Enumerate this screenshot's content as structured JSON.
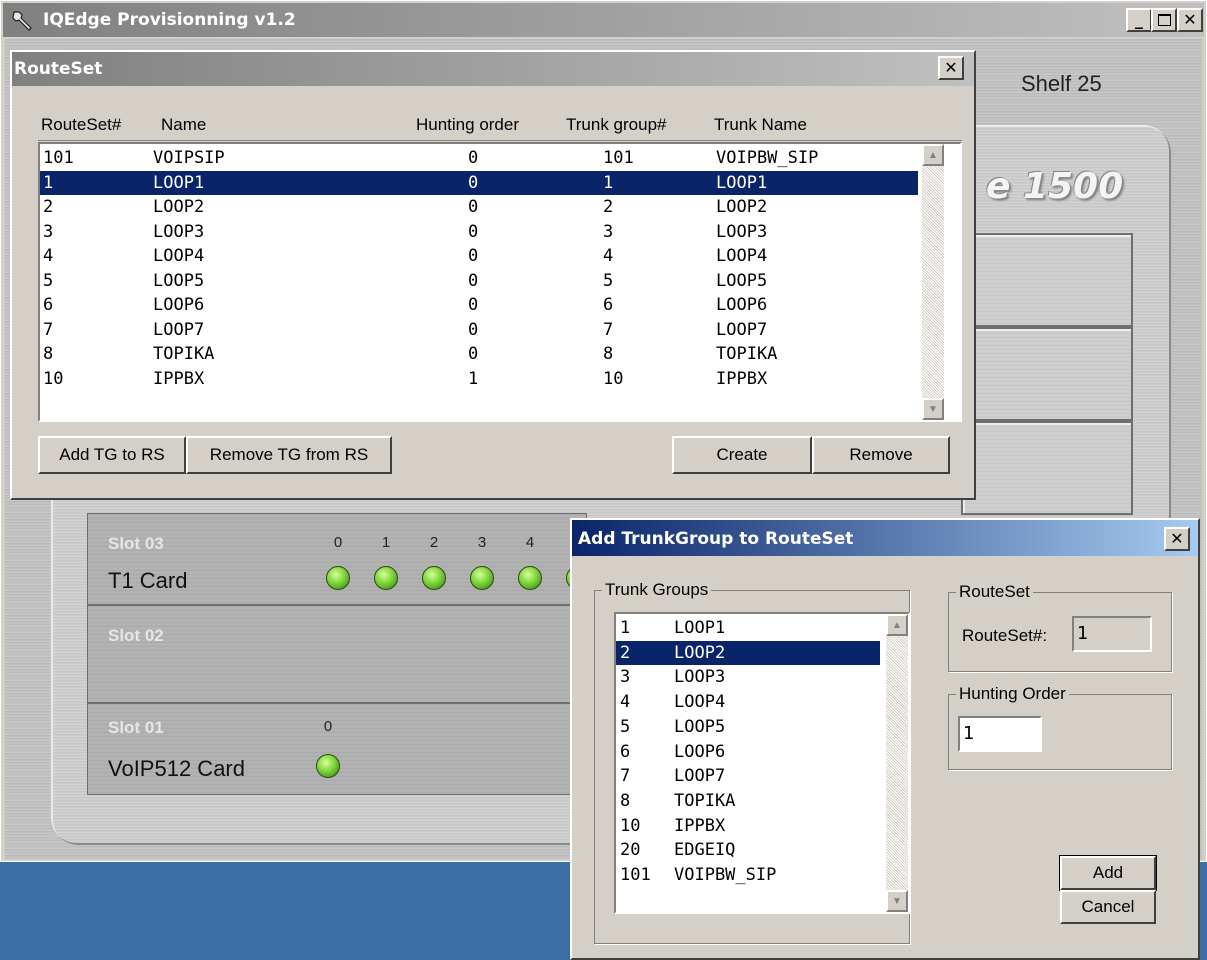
{
  "main_window": {
    "title": "IQEdge Provisionning v1.2",
    "shelf_label": "Shelf 25",
    "model_fragment": "e 1500",
    "slots": [
      {
        "title": "Slot 03",
        "card": "T1 Card",
        "ports": [
          "0",
          "1",
          "2",
          "3",
          "4"
        ]
      },
      {
        "title": "Slot 02",
        "card": "",
        "ports": []
      },
      {
        "title": "Slot 01",
        "card": "VoIP512 Card",
        "ports": [
          "0"
        ]
      }
    ]
  },
  "routeset_dialog": {
    "title": "RouteSet",
    "columns": [
      "RouteSet#",
      "Name",
      "Hunting order",
      "Trunk group#",
      "Trunk Name"
    ],
    "rows": [
      {
        "routeset": "101",
        "name": "VOIPSIP",
        "hunting": "0",
        "trunk_group": "101",
        "trunk_name": "VOIPBW_SIP"
      },
      {
        "routeset": "1",
        "name": "LOOP1",
        "hunting": "0",
        "trunk_group": "1",
        "trunk_name": "LOOP1"
      },
      {
        "routeset": "2",
        "name": "LOOP2",
        "hunting": "0",
        "trunk_group": "2",
        "trunk_name": "LOOP2"
      },
      {
        "routeset": "3",
        "name": "LOOP3",
        "hunting": "0",
        "trunk_group": "3",
        "trunk_name": "LOOP3"
      },
      {
        "routeset": "4",
        "name": "LOOP4",
        "hunting": "0",
        "trunk_group": "4",
        "trunk_name": "LOOP4"
      },
      {
        "routeset": "5",
        "name": "LOOP5",
        "hunting": "0",
        "trunk_group": "5",
        "trunk_name": "LOOP5"
      },
      {
        "routeset": "6",
        "name": "LOOP6",
        "hunting": "0",
        "trunk_group": "6",
        "trunk_name": "LOOP6"
      },
      {
        "routeset": "7",
        "name": "LOOP7",
        "hunting": "0",
        "trunk_group": "7",
        "trunk_name": "LOOP7"
      },
      {
        "routeset": "8",
        "name": "TOPIKA",
        "hunting": "0",
        "trunk_group": "8",
        "trunk_name": "TOPIKA"
      },
      {
        "routeset": "10",
        "name": "IPPBX",
        "hunting": "1",
        "trunk_group": "10",
        "trunk_name": "IPPBX"
      }
    ],
    "selected_row": "LOOP1",
    "buttons": {
      "add_tg": "Add TG to RS",
      "remove_tg": "Remove TG from RS",
      "create": "Create",
      "remove": "Remove"
    }
  },
  "add_tg_dialog": {
    "title": "Add TrunkGroup to RouteSet",
    "trunk_groups_label": "Trunk Groups",
    "trunk_groups": [
      {
        "num": "1",
        "name": "LOOP1"
      },
      {
        "num": "2",
        "name": "LOOP2"
      },
      {
        "num": "3",
        "name": "LOOP3"
      },
      {
        "num": "4",
        "name": "LOOP4"
      },
      {
        "num": "5",
        "name": "LOOP5"
      },
      {
        "num": "6",
        "name": "LOOP6"
      },
      {
        "num": "7",
        "name": "LOOP7"
      },
      {
        "num": "8",
        "name": "TOPIKA"
      },
      {
        "num": "10",
        "name": "IPPBX"
      },
      {
        "num": "20",
        "name": "EDGEIQ"
      },
      {
        "num": "101",
        "name": "VOIPBW_SIP"
      }
    ],
    "selected_trunk_group": "LOOP2",
    "routeset_group_label": "RouteSet",
    "routeset_field_label": "RouteSet#:",
    "routeset_value": "1",
    "hunting_group_label": "Hunting Order",
    "hunting_value": "1",
    "add_button": "Add",
    "cancel_button": "Cancel"
  },
  "colors": {
    "desktop": "#3a6ea5",
    "selection": "#0a246a",
    "led_green": "#7fd43a"
  }
}
